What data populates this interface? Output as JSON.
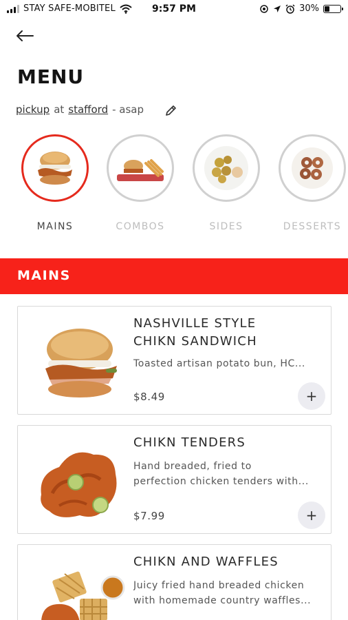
{
  "status_bar": {
    "carrier": "STAY SAFE-MOBITEL",
    "time": "9:57 PM",
    "battery": "30%",
    "battery_level": 0.3,
    "signal_bars": 3
  },
  "header": {
    "back_icon": "arrow-left-icon",
    "title": "MENU",
    "order": {
      "mode": "pickup",
      "at": "at",
      "location": "stafford",
      "timing": "- asap"
    },
    "edit_icon": "pencil-icon"
  },
  "categories": [
    {
      "label": "MAINS",
      "active": true
    },
    {
      "label": "COMBOS",
      "active": false
    },
    {
      "label": "SIDES",
      "active": false
    },
    {
      "label": "DESSERTS",
      "active": false
    }
  ],
  "section": {
    "title": "MAINS",
    "color": "#f7221a"
  },
  "items": [
    {
      "name_line1": "NASHVILLE STYLE",
      "name_line2": "CHIKN SANDWICH",
      "description": "Toasted artisan potato bun, HC...",
      "price": "$8.49",
      "add_label": "+"
    },
    {
      "name_line1": "CHIKN TENDERS",
      "description_line1": "Hand breaded, fried to",
      "description_line2": "perfection chicken tenders with...",
      "price": "$7.99",
      "add_label": "+"
    },
    {
      "name_line1": "CHIKN AND WAFFLES",
      "description_line1": "Juicy fried hand breaded chicken",
      "description_line2": "with homemade country waffles...",
      "add_label": "+"
    }
  ],
  "colors": {
    "accent": "#e52a1d",
    "band": "#f7221a",
    "add_button_bg": "#ececf1"
  }
}
